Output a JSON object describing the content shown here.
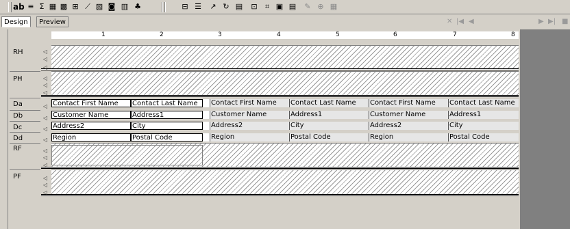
{
  "toolbar": {
    "buttons": [
      {
        "name": "text-box-icon",
        "glyph": "ab"
      },
      {
        "name": "list-icon",
        "glyph": "≡"
      },
      {
        "name": "sum-icon",
        "glyph": "Σ"
      },
      {
        "name": "table-icon",
        "glyph": "▦"
      },
      {
        "name": "grid-icon",
        "glyph": "▩"
      },
      {
        "name": "image-field-icon",
        "glyph": "⊞"
      },
      {
        "name": "line-icon",
        "glyph": "⟋"
      },
      {
        "name": "image-icon",
        "glyph": "▧"
      },
      {
        "name": "picture-icon",
        "glyph": "◙"
      },
      {
        "name": "chart-icon",
        "glyph": "▥"
      },
      {
        "name": "tree-icon",
        "glyph": "♣"
      },
      {
        "name": "subreport-icon",
        "glyph": "⊟"
      },
      {
        "name": "rich-text-icon",
        "glyph": "☰"
      },
      {
        "name": "shape-icon",
        "glyph": "↗"
      },
      {
        "name": "rotate-icon",
        "glyph": "↻"
      },
      {
        "name": "barcode-icon",
        "glyph": "▤"
      },
      {
        "name": "crosstab-icon",
        "glyph": "⊡"
      },
      {
        "name": "xml-icon",
        "glyph": "⌗"
      },
      {
        "name": "subform-icon",
        "glyph": "▣"
      },
      {
        "name": "report-icon",
        "glyph": "▤"
      },
      {
        "name": "script-icon",
        "glyph": "✎"
      },
      {
        "name": "chart-alt-icon",
        "glyph": "⊕"
      },
      {
        "name": "map-icon",
        "glyph": "▦"
      }
    ]
  },
  "tabs": [
    {
      "label": "Design",
      "active": true
    },
    {
      "label": "Preview",
      "active": false
    }
  ],
  "nav": {
    "close": "✕",
    "first": "|◀",
    "prev": "◀",
    "next": "▶",
    "last": "▶|",
    "stop": "■"
  },
  "ruler": {
    "marks": [
      "1",
      "2",
      "3",
      "4",
      "5",
      "6",
      "7",
      "8"
    ]
  },
  "bands": [
    {
      "id": "RH",
      "label": "RH"
    },
    {
      "id": "PH",
      "label": "PH"
    },
    {
      "id": "Da",
      "label": "Da"
    },
    {
      "id": "Db",
      "label": "Db"
    },
    {
      "id": "Dc",
      "label": "Dc"
    },
    {
      "id": "Dd",
      "label": "Dd"
    },
    {
      "id": "RF",
      "label": "RF"
    },
    {
      "id": "PF",
      "label": "PF"
    }
  ],
  "detail_rows": [
    [
      "Contact First Name",
      "Contact Last Name",
      "Contact First Name",
      "Contact Last Name",
      "Contact First Name",
      "Contact Last Name"
    ],
    [
      "Customer Name",
      "Address1",
      "Customer Name",
      "Address1",
      "Customer Name",
      "Address1"
    ],
    [
      "Address2",
      "City",
      "Address2",
      "City",
      "Address2",
      "City"
    ],
    [
      "Region",
      "Postal Code",
      "Region",
      "Postal Code",
      "Region",
      "Postal Code"
    ]
  ]
}
